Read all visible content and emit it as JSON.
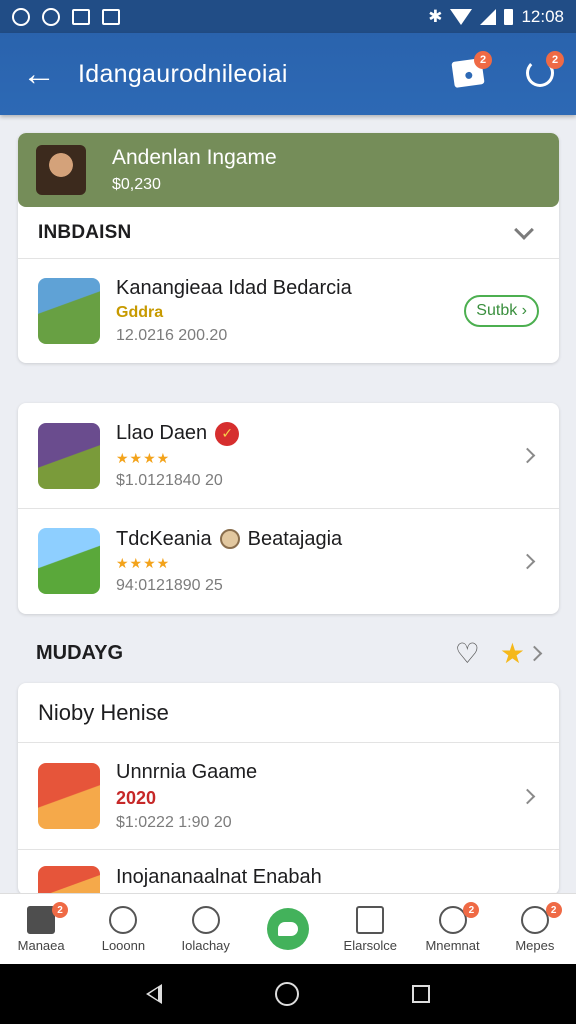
{
  "status_bar": {
    "time": "12:08"
  },
  "app_bar": {
    "title": "Idangaurodnileoiai"
  },
  "featured": {
    "title": "Andenlan Ingame",
    "price": "$0,230"
  },
  "section1": {
    "label": "INBDAISN",
    "items": [
      {
        "title": "Kanangieaa Idad Bedarcia",
        "tag": "Gddra",
        "meta": "12.0216 200.20",
        "action": "Sutbk"
      }
    ]
  },
  "card2": {
    "items": [
      {
        "title": "Llao Daen",
        "stars": "★★★★",
        "meta": "$1.0121840 20"
      },
      {
        "title": "TdcKeania",
        "title_suffix": "Beatajagia",
        "stars": "★★★★",
        "meta": "94:0121890 25"
      }
    ]
  },
  "section2": {
    "label": "MUDAYG"
  },
  "card3": {
    "title": "Nioby Henise",
    "items": [
      {
        "title": "Unnrnia Gaame",
        "year": "2020",
        "meta": "$1:0222 1:90 20"
      },
      {
        "title": "Inojananaalnat Enabah"
      }
    ]
  },
  "bottom_nav": {
    "items": [
      {
        "label": "Manaea",
        "badge": "2"
      },
      {
        "label": "Looonn"
      },
      {
        "label": "Iolachay"
      },
      {
        "label": ""
      },
      {
        "label": "Elarsolce"
      },
      {
        "label": "Mnemnat",
        "badge": "2"
      },
      {
        "label": "Mepes",
        "badge": "2"
      }
    ]
  },
  "app_bar_actions": {
    "badge1": "2",
    "badge2": "2"
  }
}
